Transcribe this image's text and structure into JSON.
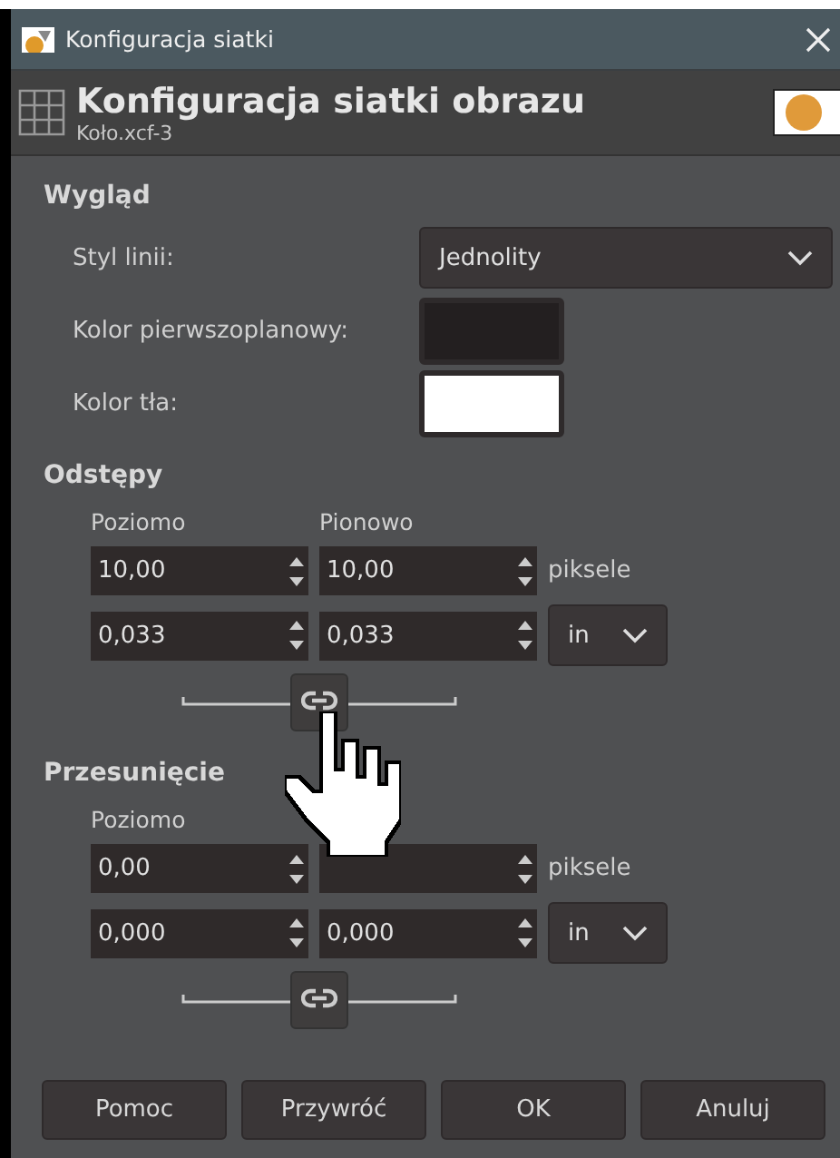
{
  "window": {
    "title": "Konfiguracja siatki"
  },
  "header": {
    "title": "Konfiguracja siatki obrazu",
    "subtitle": "Koło.xcf-3"
  },
  "appearance": {
    "heading": "Wygląd",
    "line_style": {
      "label": "Styl linii:",
      "value": "Jednolity"
    },
    "foreground": {
      "label": "Kolor pierwszoplanowy:",
      "color": "#231f20"
    },
    "background": {
      "label": "Kolor tła:",
      "color": "#ffffff"
    }
  },
  "spacing": {
    "heading": "Odstępy",
    "column_labels": [
      "Poziomo",
      "Pionowo"
    ],
    "rows": [
      {
        "values": [
          "10,00",
          "10,00"
        ],
        "unit": "piksele",
        "kind": "label"
      },
      {
        "values": [
          "0,033",
          "0,033"
        ],
        "unit": "in",
        "kind": "dropdown"
      }
    ]
  },
  "offset": {
    "heading": "Przesunięcie",
    "column_labels": [
      "Poziomo"
    ],
    "rows": [
      {
        "values": [
          "0,00"
        ],
        "unit": "piksele",
        "kind": "label"
      },
      {
        "values": [
          "0,000",
          "0,000"
        ],
        "unit": "in",
        "kind": "dropdown"
      }
    ]
  },
  "buttons": [
    "Pomoc",
    "Przywróć",
    "OK",
    "Anuluj"
  ]
}
